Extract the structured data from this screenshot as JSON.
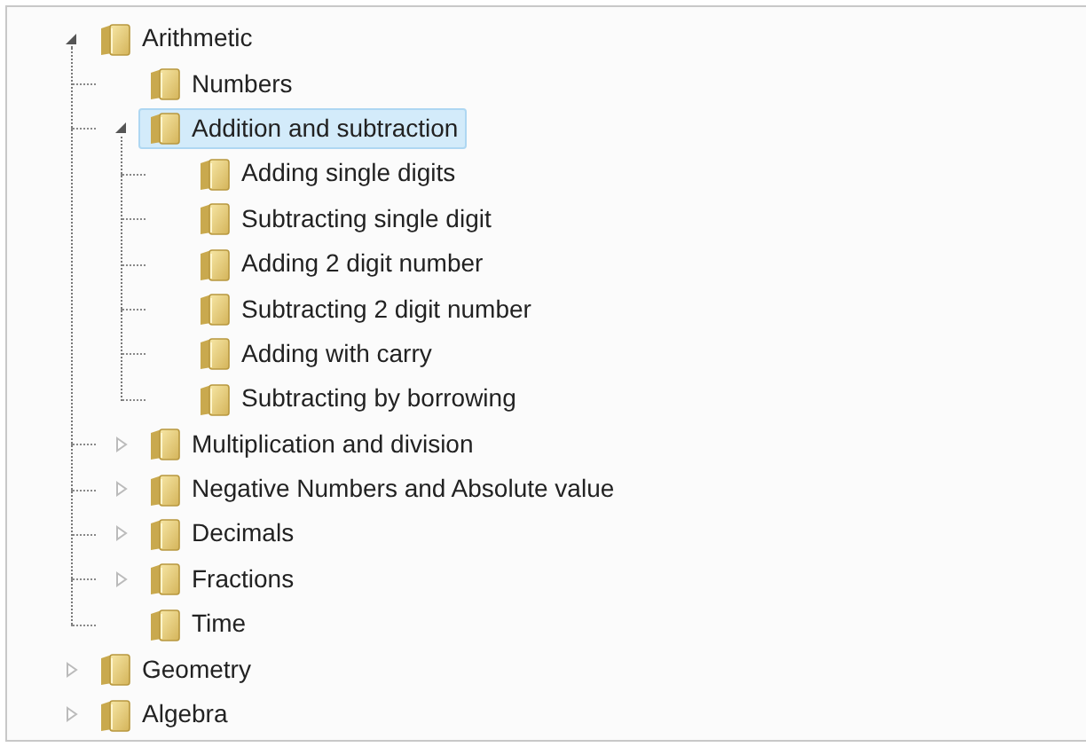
{
  "tree": [
    {
      "label": "Arithmetic",
      "expanded": true,
      "selected": false,
      "children": [
        {
          "label": "Numbers",
          "selected": false
        },
        {
          "label": "Addition and subtraction",
          "expanded": true,
          "selected": true,
          "children": [
            {
              "label": "Adding single digits",
              "selected": false
            },
            {
              "label": "Subtracting single digit",
              "selected": false
            },
            {
              "label": "Adding 2 digit number",
              "selected": false
            },
            {
              "label": "Subtracting 2 digit number",
              "selected": false
            },
            {
              "label": "Adding with carry",
              "selected": false
            },
            {
              "label": "Subtracting by borrowing",
              "selected": false
            }
          ]
        },
        {
          "label": "Multiplication and division",
          "expanded": false,
          "selected": false
        },
        {
          "label": "Negative Numbers and Absolute value",
          "expanded": false,
          "selected": false
        },
        {
          "label": "Decimals",
          "expanded": false,
          "selected": false
        },
        {
          "label": "Fractions",
          "expanded": false,
          "selected": false
        },
        {
          "label": "Time",
          "selected": false
        }
      ]
    },
    {
      "label": "Geometry",
      "expanded": false,
      "selected": false
    },
    {
      "label": "Algebra",
      "expanded": false,
      "selected": false
    }
  ]
}
